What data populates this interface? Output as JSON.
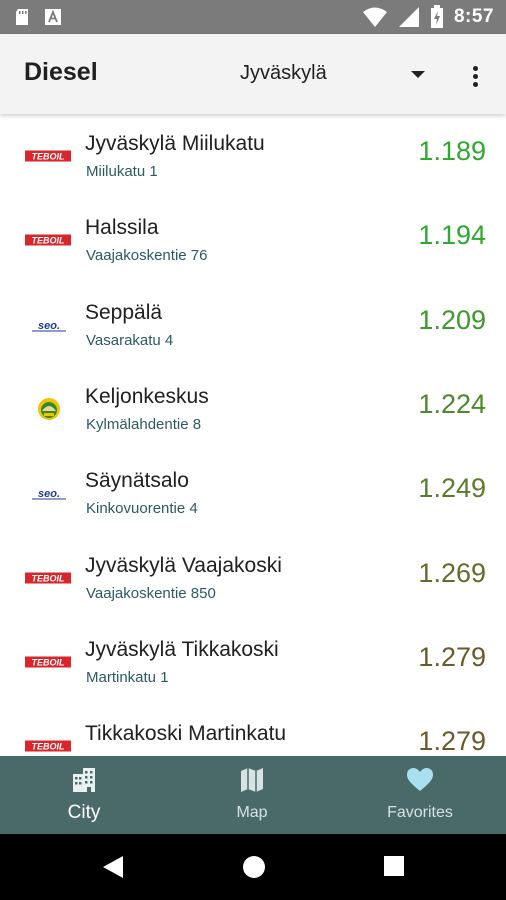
{
  "status_bar": {
    "time": "8:57",
    "icons": [
      "sd-card-icon",
      "notification-a-icon",
      "wifi-icon",
      "signal-icon",
      "battery-charging-icon"
    ]
  },
  "app_bar": {
    "title": "Diesel",
    "city": "Jyväskylä"
  },
  "colors": {
    "price_green": "#2ea82e",
    "price_olive": "#5b6b2e",
    "price_brown": "#6a5a2a",
    "nav_bg": "#4a6a6a",
    "address": "#2c5a62"
  },
  "stations": [
    {
      "brand": "TEBOIL",
      "name": "Jyväskylä Miilukatu",
      "address": "Miilukatu 1",
      "price": "1.189",
      "color": "#2ea82e"
    },
    {
      "brand": "TEBOIL",
      "name": "Halssila",
      "address": "Vaajakoskentie 76",
      "price": "1.194",
      "color": "#2ea82e"
    },
    {
      "brand": "SEO",
      "name": "Seppälä",
      "address": "Vasarakatu 4",
      "price": "1.209",
      "color": "#3a9a2a"
    },
    {
      "brand": "ABC",
      "name": "Keljonkeskus",
      "address": "Kylmälahdentie 8",
      "price": "1.224",
      "color": "#4a8a2a"
    },
    {
      "brand": "SEO",
      "name": "Säynätsalo",
      "address": "Kinkovuorentie 4",
      "price": "1.249",
      "color": "#5b7b2c"
    },
    {
      "brand": "TEBOIL",
      "name": "Jyväskylä Vaajakoski",
      "address": "Vaajakoskentie 850",
      "price": "1.269",
      "color": "#666a2c"
    },
    {
      "brand": "TEBOIL",
      "name": "Jyväskylä Tikkakoski",
      "address": "Martinkatu 1",
      "price": "1.279",
      "color": "#6a5a2a"
    },
    {
      "brand": "TEBOIL",
      "name": "Tikkakoski Martinkatu",
      "address": "",
      "price": "1.279",
      "color": "#6a5a2a"
    }
  ],
  "bottom_nav": {
    "city": "City",
    "map": "Map",
    "favorites": "Favorites"
  }
}
